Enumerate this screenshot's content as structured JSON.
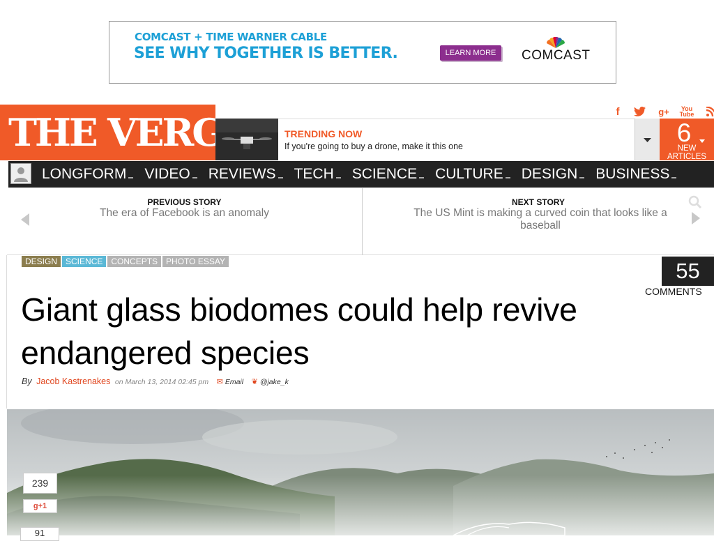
{
  "ad": {
    "line1": "COMCAST + TIME WARNER CABLE",
    "line2": "SEE WHY TOGETHER IS BETTER.",
    "button": "LEARN MORE",
    "brand": "COMCAST"
  },
  "header": {
    "logo": "THE VERGE",
    "social": [
      "facebook-icon",
      "twitter-icon",
      "google-plus-icon",
      "youtube-icon",
      "rss-icon"
    ],
    "trending_label": "TRENDING NOW",
    "trending_text": "If you're going to buy a drone, make it this one",
    "new_count": "6",
    "new_label": "NEW ARTICLES"
  },
  "nav": {
    "items": [
      "LONGFORM",
      "VIDEO",
      "REVIEWS",
      "TECH",
      "SCIENCE",
      "CULTURE",
      "DESIGN",
      "BUSINESS"
    ]
  },
  "story_nav": {
    "prev_label": "PREVIOUS STORY",
    "prev_title": "The era of Facebook is an anomaly",
    "next_label": "NEXT STORY",
    "next_title": "The US Mint is making a curved coin that looks like a baseball"
  },
  "article": {
    "tags": [
      {
        "label": "DESIGN",
        "color": "#8b7d4e"
      },
      {
        "label": "SCIENCE",
        "color": "#5bb8d6"
      },
      {
        "label": "CONCEPTS",
        "color": "#b3b3b3"
      },
      {
        "label": "PHOTO ESSAY",
        "color": "#b3b3b3"
      }
    ],
    "comment_count": "55",
    "comment_label": "COMMENTS",
    "headline": "Giant glass biodomes could help revive endangered species",
    "by": "By",
    "author": "Jacob Kastrenakes",
    "date": "on March 13, 2014 02:45 pm",
    "email_label": "Email",
    "twitter_handle": "@jake_k"
  },
  "share": {
    "count": "239",
    "gplus_label": "+1",
    "count2": "91"
  }
}
